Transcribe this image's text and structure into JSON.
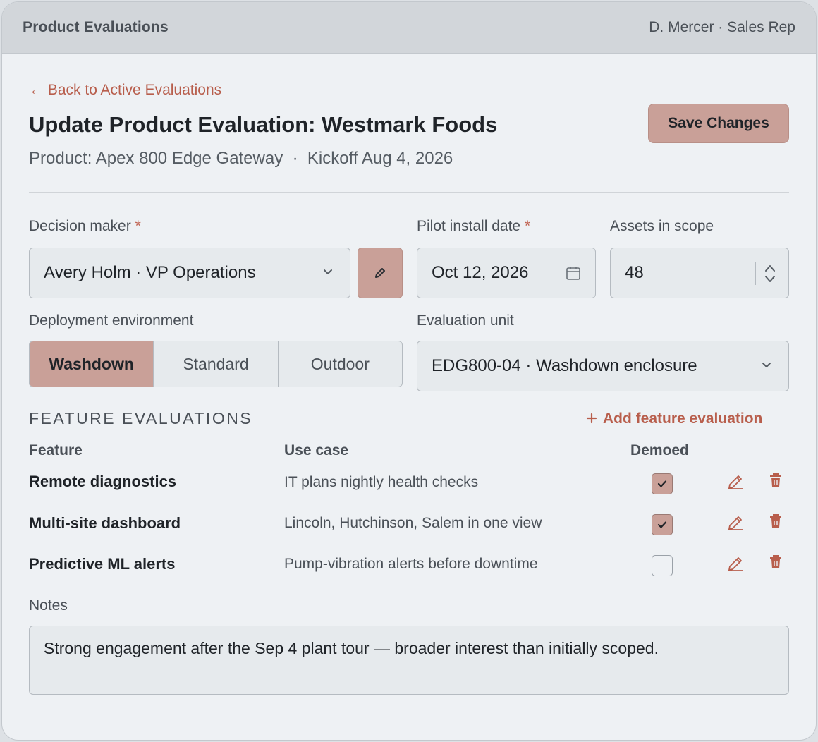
{
  "titlebar": {
    "app": "Product Evaluations",
    "user": "D. Mercer · Sales Rep"
  },
  "header": {
    "back_link": "← Back to Active Evaluations",
    "title": "Update Product Evaluation: Westmark Foods",
    "subtitle": "Product: Apex 800 Edge Gateway  ·  Kickoff Aug 4, 2026",
    "save_label": "Save Changes"
  },
  "form": {
    "decision_maker": {
      "label": "Decision maker",
      "value": "Avery Holm · VP Operations"
    },
    "pilot_date": {
      "label": "Pilot install date",
      "value": "Oct 12, 2026"
    },
    "assets": {
      "label": "Assets in scope",
      "value": "48"
    },
    "required_mark": "*",
    "environment": {
      "label": "Deployment environment",
      "options": [
        "Washdown",
        "Standard",
        "Outdoor"
      ],
      "selected": "Washdown"
    },
    "unit": {
      "label": "Evaluation unit",
      "value": "EDG800-04 · Washdown enclosure"
    }
  },
  "features": {
    "section_title": "FEATURE EVALUATIONS",
    "add_label": "Add feature evaluation",
    "add_icon": "plus-icon",
    "columns": [
      "Feature",
      "Use case",
      "Demoed"
    ],
    "rows": [
      {
        "feature": "Remote diagnostics",
        "use_case": "IT plans nightly health checks",
        "demoed": true
      },
      {
        "feature": "Multi-site dashboard",
        "use_case": "Lincoln, Hutchinson, Salem in one view",
        "demoed": true
      },
      {
        "feature": "Predictive ML alerts",
        "use_case": "Pump-vibration alerts before downtime",
        "demoed": false
      }
    ]
  },
  "notes": {
    "label": "Notes",
    "value": "Strong engagement after the Sep 4 plant tour — broader interest than initially scoped."
  },
  "colors": {
    "accent": "#c9a098",
    "link": "#b85e4c",
    "background": "#eef1f4"
  }
}
